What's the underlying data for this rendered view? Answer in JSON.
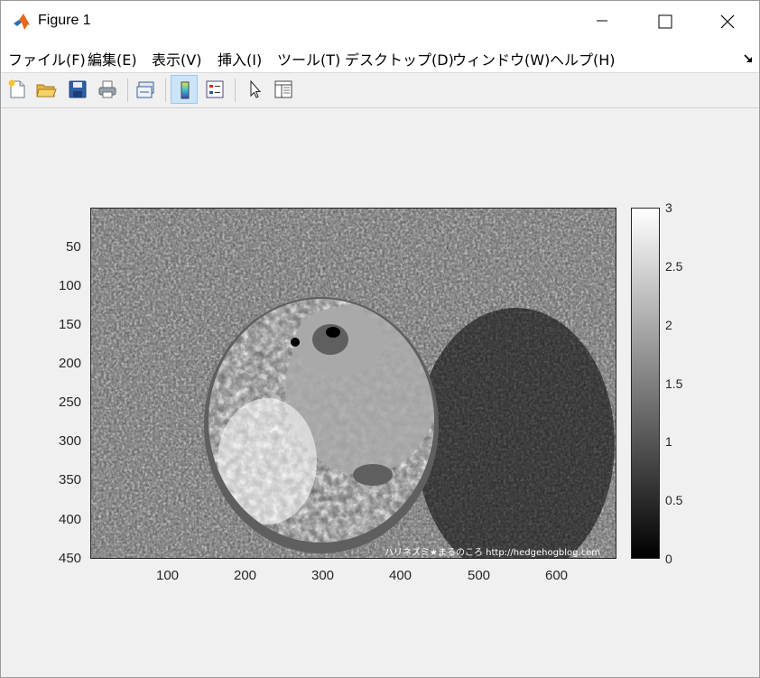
{
  "window": {
    "title": "Figure 1",
    "controls": [
      "minimize",
      "maximize",
      "close"
    ]
  },
  "menu": [
    {
      "label": "ファイル(F)"
    },
    {
      "label": "編集(E)"
    },
    {
      "label": "表示(V)"
    },
    {
      "label": "挿入(I)"
    },
    {
      "label": "ツール(T)"
    },
    {
      "label": "デスクトップ(D)"
    },
    {
      "label": "ウィンドウ(W)"
    },
    {
      "label": "ヘルプ(H)"
    }
  ],
  "toolbar": {
    "buttons": [
      {
        "icon": "new-figure-icon"
      },
      {
        "icon": "open-file-icon"
      },
      {
        "icon": "save-icon"
      },
      {
        "icon": "print-icon"
      },
      {
        "icon": "link-plot-icon"
      },
      {
        "icon": "insert-colorbar-icon",
        "active": true
      },
      {
        "icon": "insert-legend-icon"
      },
      {
        "icon": "edit-plot-icon"
      },
      {
        "icon": "property-inspector-icon"
      }
    ]
  },
  "axes": {
    "x_ticks": [
      "100",
      "200",
      "300",
      "400",
      "500",
      "600"
    ],
    "y_ticks": [
      "50",
      "100",
      "150",
      "200",
      "250",
      "300",
      "350",
      "400",
      "450"
    ]
  },
  "image": {
    "subject": "quantized grayscale hedgehog photo",
    "watermark": "ハリネズミ★まるのころ http://hedgehogblog.com"
  },
  "colorbar": {
    "ticks": [
      "0",
      "0.5",
      "1",
      "1.5",
      "2",
      "2.5",
      "3"
    ],
    "colormap": "gray"
  },
  "chart_data": {
    "type": "heatmap",
    "colormap": "gray",
    "clim": [
      0,
      3
    ],
    "xlim": [
      0.5,
      675.5
    ],
    "ylim": [
      0.5,
      450.5
    ],
    "x_ticks": [
      100,
      200,
      300,
      400,
      500,
      600
    ],
    "y_ticks": [
      50,
      100,
      150,
      200,
      250,
      300,
      350,
      400,
      450
    ],
    "colorbar_ticks": [
      0,
      0.5,
      1,
      1.5,
      2,
      2.5,
      3
    ]
  }
}
